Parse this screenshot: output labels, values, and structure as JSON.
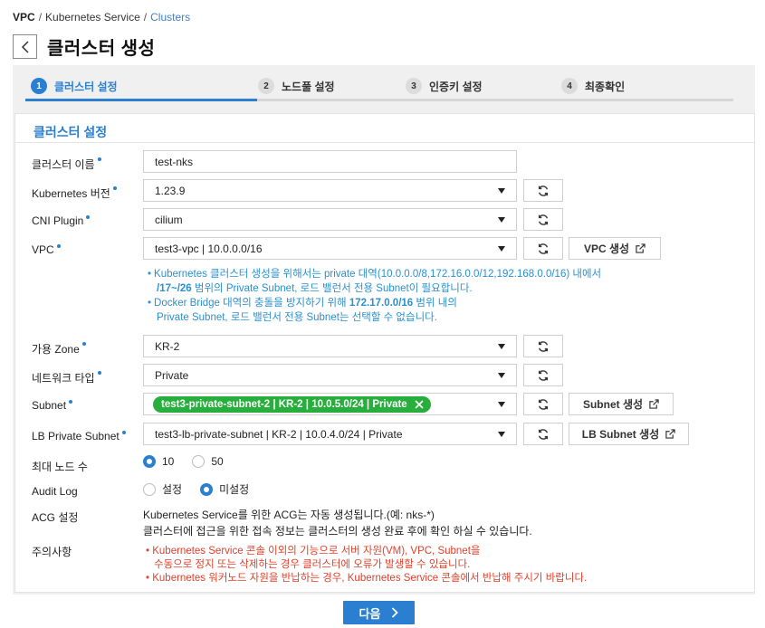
{
  "breadcrumb": {
    "vpc": "VPC",
    "service": "Kubernetes Service",
    "clusters": "Clusters"
  },
  "page": {
    "title": "클러스터 생성"
  },
  "steps": [
    {
      "num": "1",
      "label": "클러스터 설정",
      "active": true
    },
    {
      "num": "2",
      "label": "노드풀 설정",
      "active": false
    },
    {
      "num": "3",
      "label": "인증키 설정",
      "active": false
    },
    {
      "num": "4",
      "label": "최종확인",
      "active": false
    }
  ],
  "section": {
    "title": "클러스터 설정"
  },
  "form": {
    "cluster_name": {
      "label": "클러스터 이름",
      "value": "test-nks"
    },
    "k8s_version": {
      "label": "Kubernetes 버전",
      "value": "1.23.9"
    },
    "cni_plugin": {
      "label": "CNI Plugin",
      "value": "cilium"
    },
    "vpc": {
      "label": "VPC",
      "value": "test3-vpc | 10.0.0.0/16",
      "create_button": "VPC 생성"
    },
    "vpc_notes": {
      "note1_line1": "Kubernetes 클러스터 생성을 위해서는 private 대역(10.0.0.0/8,172.16.0.0/12,192.168.0.0/16) 내에서",
      "note1_line2_bold": "/17~/26",
      "note1_line2_rest": " 범위의 Private Subnet, 로드 밸런서 전용 Subnet이 필요합니다.",
      "note2_line1_pre": "Docker Bridge 대역의 충돌을 방지하기 위해 ",
      "note2_line1_bold": "172.17.0.0/16",
      "note2_line1_post": " 범위 내의",
      "note2_line2": "Private Subnet, 로드 밸런서 전용 Subnet는 선택할 수 없습니다."
    },
    "zone": {
      "label": "가용 Zone",
      "value": "KR-2"
    },
    "network_type": {
      "label": "네트워크 타입",
      "value": "Private"
    },
    "subnet": {
      "label": "Subnet",
      "chip": "test3-private-subnet-2 | KR-2 | 10.0.5.0/24 | Private",
      "create_button": "Subnet 생성"
    },
    "lb_subnet": {
      "label": "LB Private Subnet",
      "value": "test3-lb-private-subnet | KR-2 | 10.0.4.0/24 | Private",
      "create_button": "LB Subnet 생성"
    },
    "max_nodes": {
      "label": "최대 노드 수",
      "options": [
        "10",
        "50"
      ],
      "selected": "10"
    },
    "audit_log": {
      "label": "Audit Log",
      "options": [
        "설정",
        "미설정"
      ],
      "selected": "미설정"
    },
    "acg": {
      "label": "ACG 설정",
      "line1": "Kubernetes Service를 위한 ACG는 자동 생성됩니다.(예: nks-*)",
      "line2": "클러스터에 접근을 위한 접속 정보는 클러스터의 생성 완료 후에 확인 하실 수 있습니다."
    },
    "caution": {
      "label": "주의사항",
      "w1_line1": "Kubernetes Service 콘솔 이외의 기능으로 서버 자원(VM), VPC, Subnet을",
      "w1_line2": "수동으로 정지 또는 삭제하는 경우 클러스터에 오류가 발생할 수 있습니다.",
      "w2": "Kubernetes 워커노드 자원을 반납하는 경우, Kubernetes Service 콘솔에서 반납해 주시기 바랍니다."
    }
  },
  "footer": {
    "next_label": "다음"
  },
  "colors": {
    "accent": "#2b7fd0",
    "chip": "#27ae3c",
    "warning": "#e0412b",
    "note": "#2b8fd0"
  },
  "icons": {
    "back": "chevron-left-icon",
    "refresh": "refresh-icon",
    "external": "external-link-icon",
    "remove": "close-icon",
    "next": "chevron-right-icon"
  }
}
